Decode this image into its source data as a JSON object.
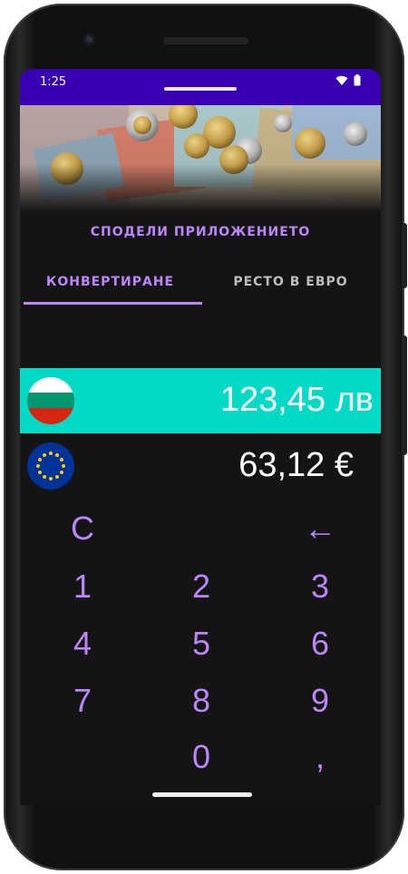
{
  "status_bar": {
    "time": "1:25",
    "icons": [
      "wifi-icon",
      "battery-icon"
    ],
    "color": "#3700b3"
  },
  "banner": {
    "image": "euro-coins-and-banknotes-photo"
  },
  "share_label": "СПОДЕЛИ ПРИЛОЖЕНИЕТО",
  "tabs": [
    {
      "label": "КОНВЕРТИРАНЕ",
      "active": true
    },
    {
      "label": "РЕСТО В ЕВРО",
      "active": false
    }
  ],
  "converter": {
    "bgn": {
      "flag": "bulgaria-flag-icon",
      "amount": "123,45 лв",
      "highlight_color": "#03dac5"
    },
    "eur": {
      "flag": "eu-flag-icon",
      "amount": "63,12 €"
    }
  },
  "keypad": {
    "clear": "C",
    "backspace": "←",
    "keys": [
      "1",
      "2",
      "3",
      "4",
      "5",
      "6",
      "7",
      "8",
      "9",
      "0",
      ","
    ],
    "color": "#bb86fc"
  }
}
